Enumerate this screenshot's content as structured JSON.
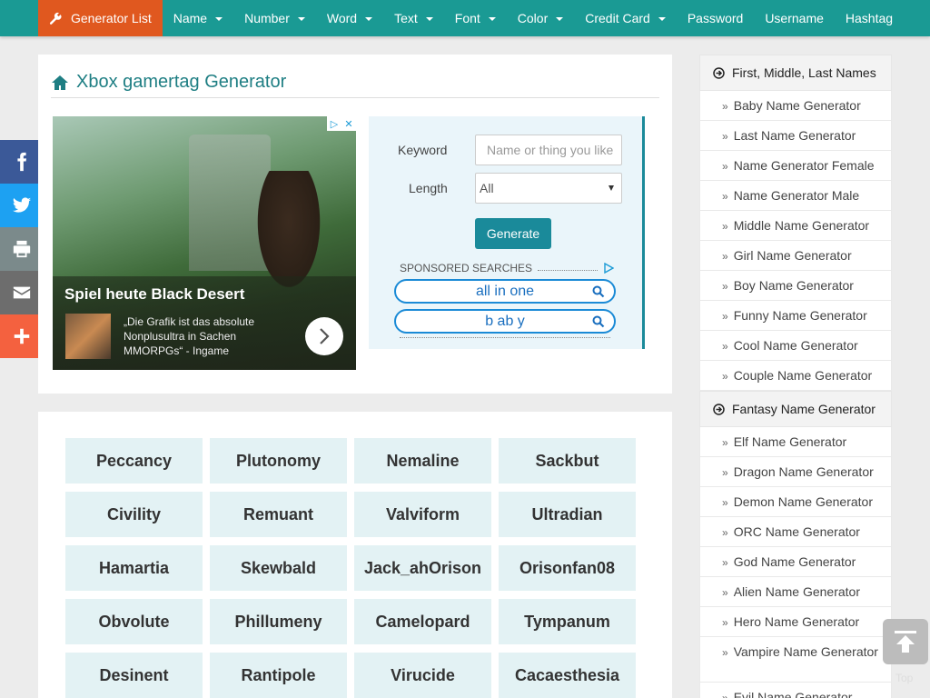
{
  "nav": {
    "items": [
      {
        "label": "Generator List",
        "active": true,
        "dropdown": false,
        "icon": "wrench-icon"
      },
      {
        "label": "Name",
        "dropdown": true
      },
      {
        "label": "Number",
        "dropdown": true
      },
      {
        "label": "Word",
        "dropdown": true
      },
      {
        "label": "Text",
        "dropdown": true
      },
      {
        "label": "Font",
        "dropdown": true
      },
      {
        "label": "Color",
        "dropdown": true
      },
      {
        "label": "Credit Card",
        "dropdown": true
      },
      {
        "label": "Password",
        "dropdown": false
      },
      {
        "label": "Username",
        "dropdown": false
      },
      {
        "label": "Hashtag",
        "dropdown": false
      }
    ],
    "colors": {
      "bar": "#1a9a94",
      "active": "#e0581f"
    }
  },
  "page": {
    "title": "Xbox gamertag Generator",
    "title_icon": "home-icon"
  },
  "ad": {
    "headline": "Spiel heute Black Desert",
    "description": "„Die Grafik ist das absolute Nonplusultra in Sachen MMORPGs“ - Ingame",
    "badge_icons": [
      "adchoices-icon",
      "close-icon"
    ],
    "next_icon": "chevron-right-icon"
  },
  "form": {
    "keyword_label": "Keyword",
    "keyword_placeholder": "Name or thing you like",
    "length_label": "Length",
    "length_value": "All",
    "generate_label": "Generate",
    "sponsored_label": "SPONSORED SEARCHES",
    "searches": [
      "all in one",
      "b ab y"
    ]
  },
  "results": {
    "names": [
      "Peccancy",
      "Plutonomy",
      "Nemaline",
      "Sackbut",
      "Civility",
      "Remuant",
      "Valviform",
      "Ultradian",
      "Hamartia",
      "Skewbald",
      "Jack_ahOrison",
      "Orisonfan08",
      "Obvolute",
      "Phillumeny",
      "Camelopard",
      "Tympanum",
      "Desinent",
      "Rantipole",
      "Virucide",
      "Cacaesthesia"
    ]
  },
  "sidebar": {
    "sections": [
      {
        "heading": "First, Middle, Last Names",
        "items": [
          "Baby Name Generator",
          "Last Name Generator",
          "Name Generator Female",
          "Name Generator Male",
          "Middle Name Generator",
          "Girl Name Generator",
          "Boy Name Generator",
          "Funny Name Generator",
          "Cool Name Generator",
          "Couple Name Generator"
        ]
      },
      {
        "heading": "Fantasy Name Generator",
        "items": [
          "Elf Name Generator",
          "Dragon Name Generator",
          "Demon Name Generator",
          "ORC Name Generator",
          "God Name Generator",
          "Alien Name Generator",
          "Hero Name Generator",
          "Vampire Name Generator",
          "Evil Name Generator"
        ]
      }
    ]
  },
  "share": [
    {
      "icon": "facebook-icon",
      "color": "#3b5998"
    },
    {
      "icon": "twitter-icon",
      "color": "#1da1f2"
    },
    {
      "icon": "print-icon",
      "color": "#7b8a8b"
    },
    {
      "icon": "email-icon",
      "color": "#6d6d6d"
    },
    {
      "icon": "plus-icon",
      "color": "#f4613f"
    }
  ],
  "to_top": {
    "label": "Top",
    "icon": "arrow-up-icon"
  }
}
